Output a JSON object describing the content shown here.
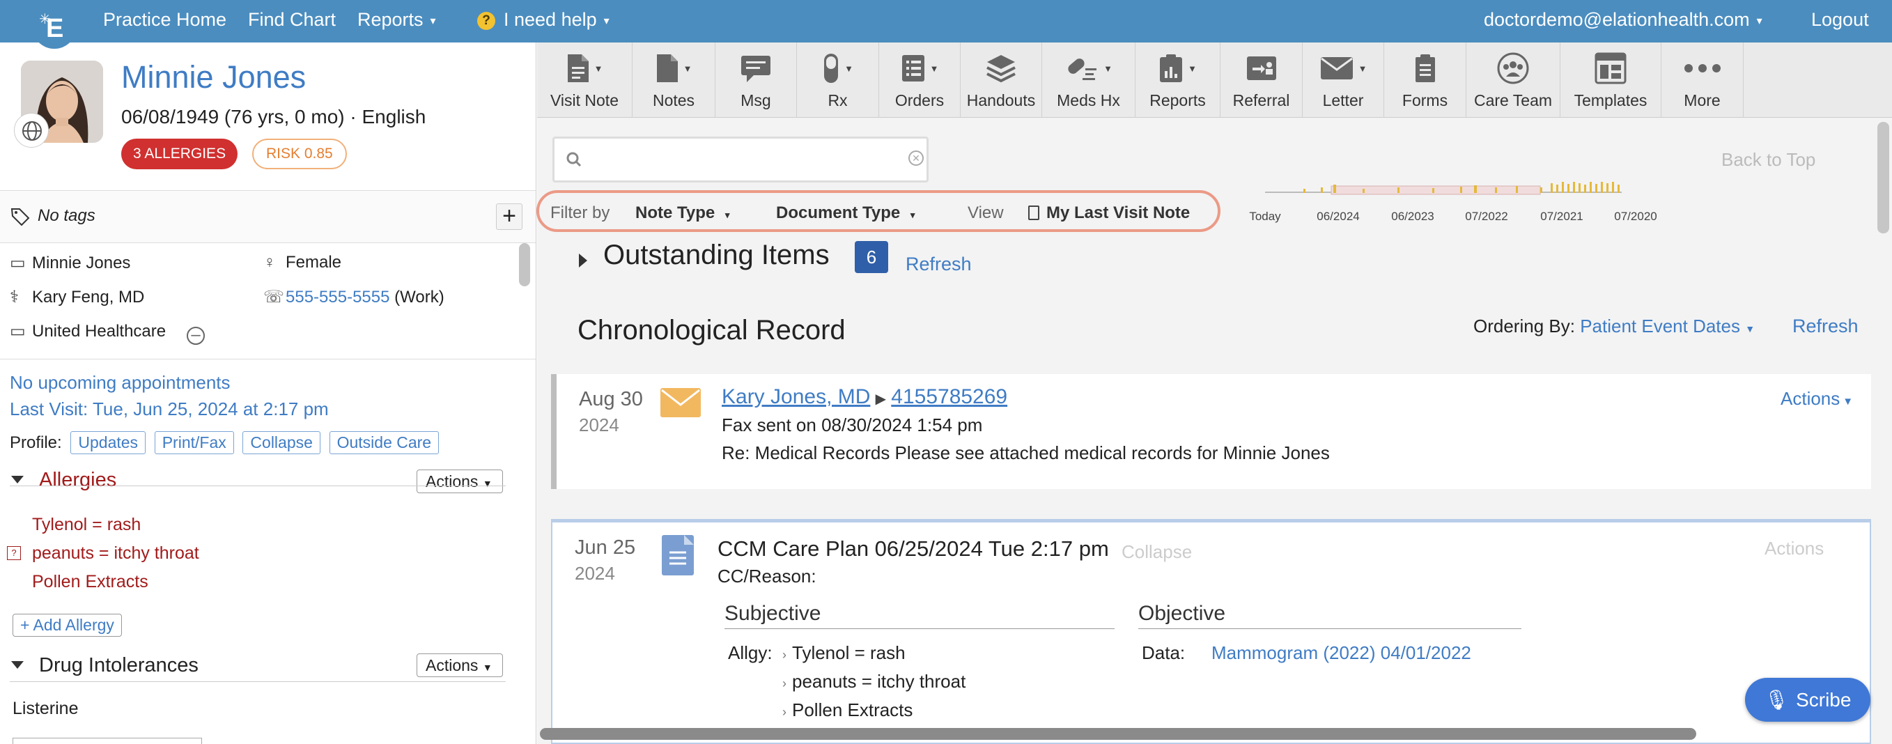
{
  "topnav": {
    "items": [
      "Practice Home",
      "Find Chart",
      "Reports",
      "I need help"
    ],
    "user": "doctordemo@elationhealth.com",
    "logout": "Logout",
    "logo_letter": "E"
  },
  "patient": {
    "name": "Minnie Jones",
    "dob_line": "06/08/1949 (76 yrs, 0 mo) · English",
    "allergy_badge": "3 ALLERGIES",
    "risk_badge": "RISK 0.85",
    "tags": "No tags",
    "info": {
      "name": "Minnie Jones",
      "gender": "Female",
      "provider": "Kary Feng, MD",
      "phone": "555-555-5555",
      "phone_type": "(Work)",
      "insurance": "United Healthcare"
    },
    "appointments": "No upcoming appointments",
    "last_visit": "Last Visit: Tue, Jun 25, 2024 at 2:17 pm",
    "profile_label": "Profile:",
    "profile_buttons": [
      "Updates",
      "Print/Fax",
      "Collapse",
      "Outside Care"
    ]
  },
  "allergies": {
    "title": "Allergies",
    "actions": "Actions",
    "items": [
      "Tylenol = rash",
      "peanuts = itchy throat",
      "Pollen Extracts"
    ],
    "add": "+ Add Allergy"
  },
  "drug_intolerances": {
    "title": "Drug Intolerances",
    "actions": "Actions",
    "items": [
      "Listerine"
    ]
  },
  "toolbar": [
    {
      "label": "Visit Note",
      "caret": true
    },
    {
      "label": "Notes",
      "caret": true
    },
    {
      "label": "Msg",
      "caret": false
    },
    {
      "label": "Rx",
      "caret": true
    },
    {
      "label": "Orders",
      "caret": true
    },
    {
      "label": "Handouts",
      "caret": false
    },
    {
      "label": "Meds Hx",
      "caret": true
    },
    {
      "label": "Reports",
      "caret": true
    },
    {
      "label": "Referral",
      "caret": false
    },
    {
      "label": "Letter",
      "caret": true
    },
    {
      "label": "Forms",
      "caret": false
    },
    {
      "label": "Care Team",
      "caret": false
    },
    {
      "label": "Templates",
      "caret": false
    },
    {
      "label": "More",
      "caret": false
    }
  ],
  "search": {
    "placeholder": ""
  },
  "timeline": {
    "ticks": [
      "Today",
      "06/2024",
      "06/2023",
      "07/2022",
      "07/2021",
      "07/2020"
    ]
  },
  "back_to_top": "Back to Top",
  "filter": {
    "filter_by": "Filter by",
    "note_type": "Note Type",
    "document_type": "Document Type",
    "view": "View",
    "my_last_visit_note": "My Last Visit Note"
  },
  "outstanding": {
    "title": "Outstanding Items",
    "count": "6",
    "refresh": "Refresh"
  },
  "chronological": {
    "title": "Chronological Record",
    "ordering_label": "Ordering By:",
    "ordering_value": "Patient Event Dates",
    "refresh": "Refresh"
  },
  "records": [
    {
      "date": "Aug 30",
      "year": "2024",
      "from": "Kary Jones, MD",
      "to": "4155785269",
      "line1": "Fax sent on 08/30/2024 1:54 pm",
      "line2": "Re: Medical Records Please see attached medical records for Minnie Jones",
      "actions": "Actions"
    },
    {
      "date": "Jun 25",
      "year": "2024",
      "title": "CCM Care Plan 06/25/2024 Tue 2:17 pm",
      "collapse": "Collapse",
      "actions": "Actions",
      "reason": "CC/Reason:",
      "subjective": "Subjective",
      "allgy_label": "Allgy:",
      "allgy": [
        "Tylenol = rash",
        "peanuts = itchy throat",
        "Pollen Extracts"
      ],
      "objective": "Objective",
      "data_label": "Data:",
      "data_value": "Mammogram (2022) 04/01/2022"
    }
  ],
  "scribe": "Scribe",
  "colors": {
    "nav": "#4b8dbf",
    "link": "#3f7cc4",
    "allergy": "#a11b1b",
    "badge_red": "#d0302f",
    "risk": "#e57f30",
    "highlight": "#eb9a86"
  }
}
